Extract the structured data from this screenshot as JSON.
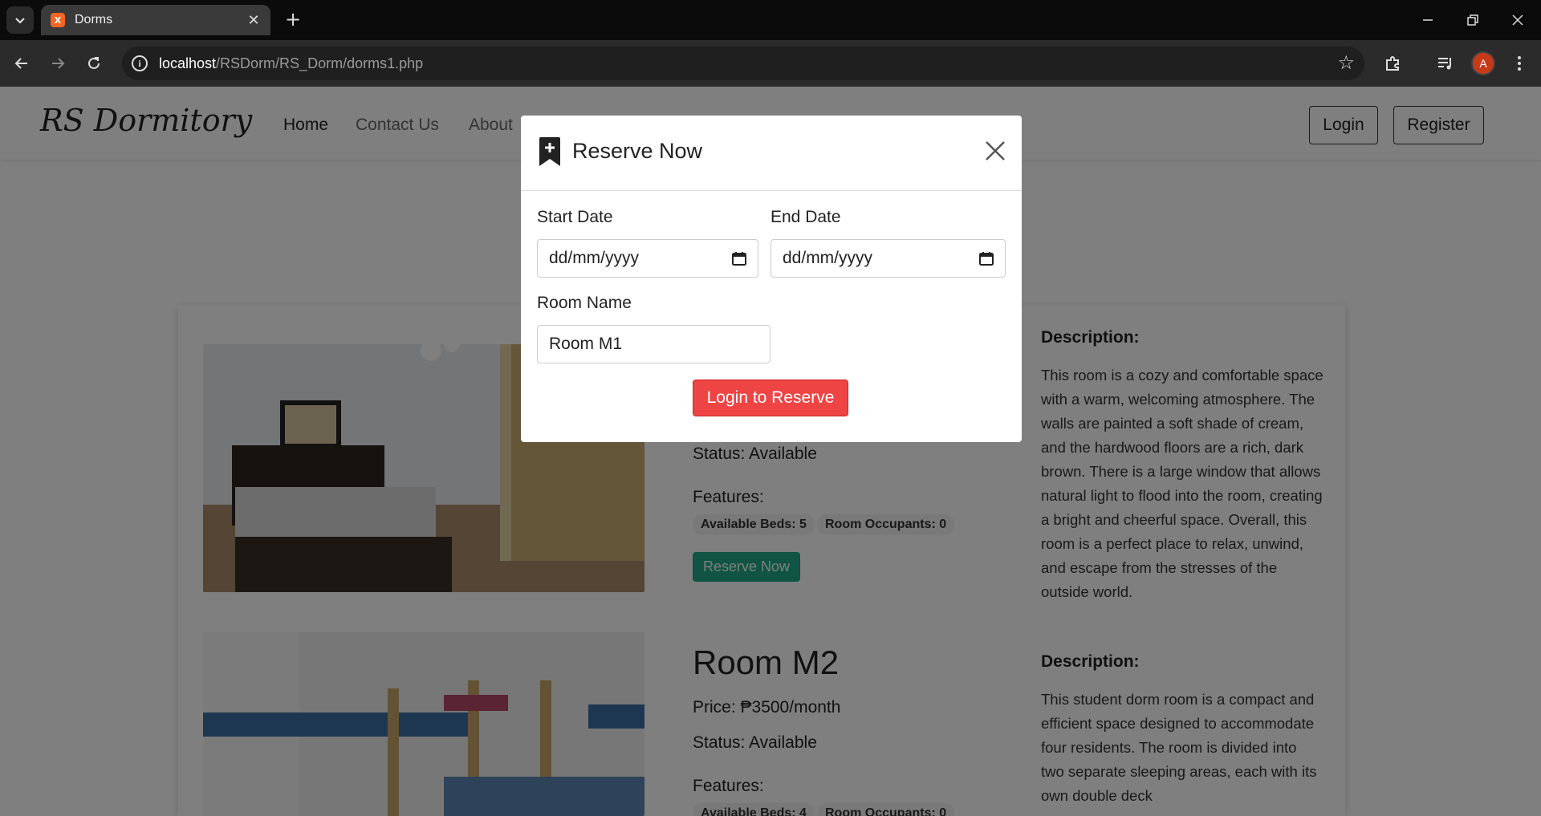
{
  "browser": {
    "tab_title": "Dorms",
    "url_host": "localhost",
    "url_path": "/RSDorm/RS_Dorm/dorms1.php",
    "profile_initial": "A"
  },
  "site": {
    "brand": "RS Dormitory",
    "nav": [
      "Home",
      "Contact Us",
      "About"
    ],
    "login_label": "Login",
    "register_label": "Register"
  },
  "rooms": [
    {
      "name": "Room M1",
      "status": "Status: Available",
      "features_label": "Features:",
      "beds": "Available Beds: 5",
      "occupants": "Room Occupants: 0",
      "reserve_label": "Reserve Now",
      "desc_title": "Description:",
      "description": "This room is a cozy and comfortable space with a warm, welcoming atmosphere. The walls are painted a soft shade of cream, and the hardwood floors are a rich, dark brown. There is a large window that allows natural light to flood into the room, creating a bright and cheerful space. Overall, this room is a perfect place to relax, unwind, and escape from the stresses of the outside world."
    },
    {
      "name": "Room M2",
      "price": "Price: ₱3500/month",
      "status": "Status: Available",
      "features_label": "Features:",
      "beds": "Available Beds: 4",
      "occupants": "Room Occupants: 0",
      "desc_title": "Description:",
      "description": "This student dorm room is a compact and efficient space designed to accommodate four residents. The room is divided into two separate sleeping areas, each with its own double deck"
    }
  ],
  "modal": {
    "title": "Reserve Now",
    "start_label": "Start Date",
    "start_value": "dd/mm/yyyy",
    "end_label": "End Date",
    "end_value": "dd/mm/yyyy",
    "room_label": "Room Name",
    "room_value": "Room M1",
    "submit_label": "Login to Reserve"
  },
  "colors": {
    "accent_green": "#20a986",
    "accent_red": "#ef4444"
  }
}
